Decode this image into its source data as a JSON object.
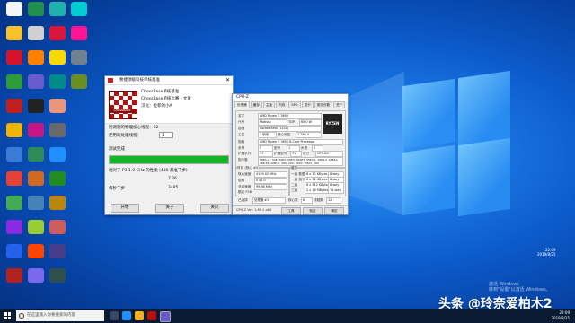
{
  "desktop": {
    "icon_colors": [
      "#f5f5f5",
      "#f6c12a",
      "#d4142a",
      "#2e9b3a",
      "#c02020",
      "#f0b400",
      "#3a7bd5",
      "#e34234",
      "#44aa55",
      "#8a2be2",
      "#2563eb",
      "#b22222",
      "#1f8f4e",
      "#d0d0d0",
      "#ff7f00",
      "#6a5acd",
      "#222222",
      "#c71585",
      "#2e8b57",
      "#d2691e",
      "#4682b4",
      "#9acd32",
      "#ff4500",
      "#7b68ee",
      "#20b2aa",
      "#dc143c",
      "#ffd700",
      "#008b8b",
      "#e9967a",
      "#696969",
      "#1e90ff",
      "#228b22",
      "#b8860b",
      "#cd5c5c",
      "#483d8b",
      "#2f4f4f",
      "#00ced1",
      "#ff1493",
      "#708090",
      "#6b8e23",
      "#ba55d3",
      "#8b0000",
      "#5f9ea0",
      "#daa520",
      "#9932cc",
      "#3cb371",
      "#ff6347",
      "#4169e1",
      "#a0522d",
      "#778899"
    ]
  },
  "benchmark": {
    "title": "希捷顶级科技单核基准",
    "line1": "ChessBase单核基准",
    "line2": "ChessBase单核比赛 - 文爱",
    "line3": "汉化：拉菲的小A",
    "logo_text": "ChessBase",
    "threads_label": "检测到的物理核心线程：12",
    "use_threads_label": "使用的处理线程：",
    "use_threads_value": "1",
    "test_done_label": "测试完成",
    "progress": 1.0,
    "score_label": "相对于 P3 1.0 GHz 的性能 (480 基准千步)",
    "score_value": "7.26",
    "kn_label": "每秒千步",
    "kn_value": "3485",
    "btn_start": "开始",
    "btn_about": "关于",
    "btn_close": "关闭"
  },
  "cpuz": {
    "title": "CPU-Z",
    "tabs": [
      "处理器",
      "缓存",
      "主板",
      "内存",
      "SPD",
      "显卡",
      "测试分数",
      "关于"
    ],
    "processor_group": "处理器",
    "name_label": "名字",
    "name_value": "AMD Ryzen 5 3600",
    "code_label": "代号",
    "code_value": "Matisse",
    "tdp_label": "TDP",
    "tdp_value": "65.0 W",
    "socket_label": "插槽",
    "socket_value": "Socket AM4 (1331)",
    "tech_label": "工艺",
    "tech_value": "7 纳米",
    "voltage_label": "核心电压",
    "voltage_value": "1.288 V",
    "spec_label": "规格",
    "spec_value": "AMD Ryzen 5 3600 6-Core Processor",
    "family_label": "系列",
    "family_value": "F",
    "model_label": "型号",
    "model_value": "1",
    "stepping_label": "步进",
    "stepping_value": "0",
    "extfamily_label": "扩展系列",
    "extfamily_value": "17",
    "extmodel_label": "扩展型号",
    "extmodel_value": "71",
    "revision_label": "修订",
    "revision_value": "MTS-B0",
    "inst_label": "指令集",
    "inst_value": "MMX(+), SSE, SSE2, SSE3, SSSE3, SSE4.1, SSE4.2, SSE4A, x86-64, AMD-V, AES, AVX, AVX2, FMA3, SHA",
    "clocks_group": "时钟 (核心 #0)",
    "core_speed_label": "核心速度",
    "core_speed_value": "4199.02 MHz",
    "mult_label": "倍频",
    "mult_value": "x 42.0",
    "bus_label": "总线速度",
    "bus_value": "99.98 MHz",
    "fsb_label": "额定 FSB",
    "cache_group": "缓存",
    "l1d_label": "一级 数据",
    "l1d_value": "6 x 32 KBytes",
    "l1d_way": "8-way",
    "l1i_label": "一级 指令",
    "l1i_value": "6 x 32 KBytes",
    "l1i_way": "8-way",
    "l2_label": "二级",
    "l2_value": "6 x 512 KBytes",
    "l2_way": "8-way",
    "l3_label": "三级",
    "l3_value": "2 x 16 MBytes",
    "l3_way": "16-way",
    "selected_label": "已选择",
    "selected_value": "处理器 #1",
    "cores_label": "核心数",
    "cores_value": "6",
    "threads_label": "线程数",
    "threads_value": "12",
    "version": "CPU-Z  Ver. 1.89.1.x64",
    "tools_btn": "工具",
    "validate_btn": "验证",
    "ok_btn": "确定",
    "logo": "RYZEN"
  },
  "taskbar": {
    "search_placeholder": "在这里输入你要搜索的内容",
    "time": "22:09",
    "date": "2019/8/25",
    "corner_time": "22:09",
    "corner_date": "2019/8/25"
  },
  "overlay": {
    "activate_line1": "激活 Windows",
    "activate_line2": "转到\"设置\"以激活 Windows。",
    "watermark": "头条 @玲奈爱柏木2"
  }
}
